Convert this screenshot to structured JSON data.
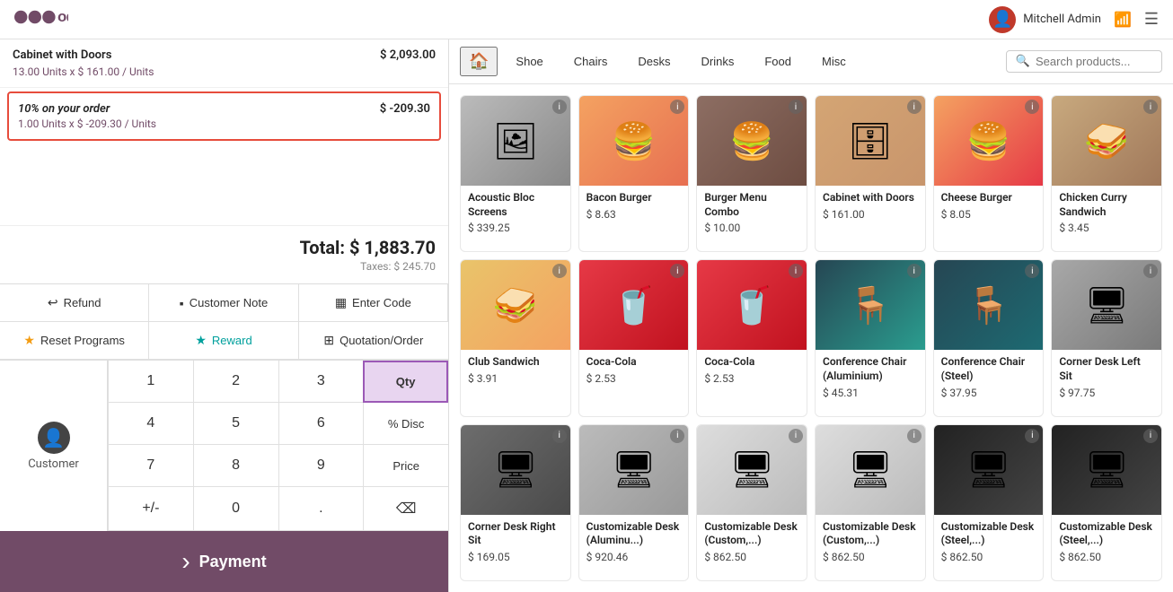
{
  "topbar": {
    "logo": "odoo",
    "user": "Mitchell Admin",
    "wifi_icon": "📶",
    "menu_icon": "☰"
  },
  "order": {
    "lines": [
      {
        "name": "Cabinet with Doors",
        "detail": "13.00  Units x $ 161.00 / Units",
        "amount": "$ 2,093.00",
        "highlighted": false
      }
    ],
    "discount": {
      "name": "10% on your order",
      "detail": "1.00  Units x $ -209.30 / Units",
      "amount": "$ -209.30",
      "highlighted": true
    },
    "total_label": "Total:",
    "total_amount": "$ 1,883.70",
    "taxes_label": "Taxes:",
    "taxes_amount": "$ 245.70"
  },
  "action_buttons": [
    {
      "id": "refund",
      "icon": "↩",
      "label": "Refund"
    },
    {
      "id": "customer-note",
      "icon": "▪",
      "label": "Customer Note"
    },
    {
      "id": "enter-code",
      "icon": "▦",
      "label": "Enter Code"
    },
    {
      "id": "reset-programs",
      "icon": "★",
      "label": "Reset Programs"
    },
    {
      "id": "reward",
      "icon": "★",
      "label": "Reward",
      "color": "teal"
    },
    {
      "id": "quotation-order",
      "icon": "⊞",
      "label": "Quotation/Order"
    }
  ],
  "numpad": {
    "customer_label": "Customer",
    "keys": [
      "1",
      "2",
      "3",
      "Qty",
      "4",
      "5",
      "6",
      "% Disc",
      "7",
      "8",
      "9",
      "Price",
      "+/-",
      "0",
      ".",
      "⌫"
    ]
  },
  "payment": {
    "arrow": ">",
    "label": "Payment"
  },
  "categories": {
    "home_icon": "🏠",
    "items": [
      "Shoe",
      "Chairs",
      "Desks",
      "Drinks",
      "Food",
      "Misc"
    ],
    "search_placeholder": "Search products..."
  },
  "products": [
    {
      "id": "acoustic",
      "name": "Acoustic Bloc Screens",
      "price": "$ 339.25",
      "img_class": "pi-acoustic",
      "emoji": "🖼"
    },
    {
      "id": "bacon-burger",
      "name": "Bacon Burger",
      "price": "$ 8.63",
      "img_class": "pi-bacon",
      "emoji": "🍔"
    },
    {
      "id": "burger-menu",
      "name": "Burger Menu Combo",
      "price": "$ 10.00",
      "img_class": "pi-burger-combo",
      "emoji": "🍔"
    },
    {
      "id": "cabinet-doors",
      "name": "Cabinet with Doors",
      "price": "$ 161.00",
      "img_class": "pi-cabinet",
      "emoji": "🗄"
    },
    {
      "id": "cheese-burger",
      "name": "Cheese Burger",
      "price": "$ 8.05",
      "img_class": "pi-cheese",
      "emoji": "🍔"
    },
    {
      "id": "chicken-curry",
      "name": "Chicken Curry Sandwich",
      "price": "$ 3.45",
      "img_class": "pi-chicken",
      "emoji": "🥪"
    },
    {
      "id": "club-sandwich",
      "name": "Club Sandwich",
      "price": "$ 3.91",
      "img_class": "pi-club",
      "emoji": "🥪"
    },
    {
      "id": "coca-cola-1",
      "name": "Coca-Cola",
      "price": "$ 2.53",
      "img_class": "pi-coca1",
      "emoji": "🥤"
    },
    {
      "id": "coca-cola-2",
      "name": "Coca-Cola",
      "price": "$ 2.53",
      "img_class": "pi-coca2",
      "emoji": "🥤"
    },
    {
      "id": "conf-chair-al",
      "name": "Conference Chair (Aluminium)",
      "price": "$ 45.31",
      "img_class": "pi-conf-al",
      "emoji": "🪑"
    },
    {
      "id": "conf-chair-st",
      "name": "Conference Chair (Steel)",
      "price": "$ 37.95",
      "img_class": "pi-conf-st",
      "emoji": "🪑"
    },
    {
      "id": "corner-desk-l",
      "name": "Corner Desk Left Sit",
      "price": "$ 97.75",
      "img_class": "pi-corner-l",
      "emoji": "🖥"
    },
    {
      "id": "corner-desk-r",
      "name": "Corner Desk Right Sit",
      "price": "$ 169.05",
      "img_class": "pi-corner-r",
      "emoji": "🖥"
    },
    {
      "id": "custom-desk-al",
      "name": "Customizable Desk (Aluminu...)",
      "price": "$ 920.46",
      "img_class": "pi-custom-al",
      "emoji": "🖥"
    },
    {
      "id": "custom-desk-c1",
      "name": "Customizable Desk (Custom,...)",
      "price": "$ 862.50",
      "img_class": "pi-custom-c1",
      "emoji": "🖥"
    },
    {
      "id": "custom-desk-c2",
      "name": "Customizable Desk (Custom,...)",
      "price": "$ 862.50",
      "img_class": "pi-custom-c2",
      "emoji": "🖥"
    },
    {
      "id": "custom-desk-s1",
      "name": "Customizable Desk (Steel,...)",
      "price": "$ 862.50",
      "img_class": "pi-custom-s1",
      "emoji": "🖥"
    },
    {
      "id": "custom-desk-s2",
      "name": "Customizable Desk (Steel,...)",
      "price": "$ 862.50",
      "img_class": "pi-custom-s2",
      "emoji": "🖥"
    }
  ]
}
